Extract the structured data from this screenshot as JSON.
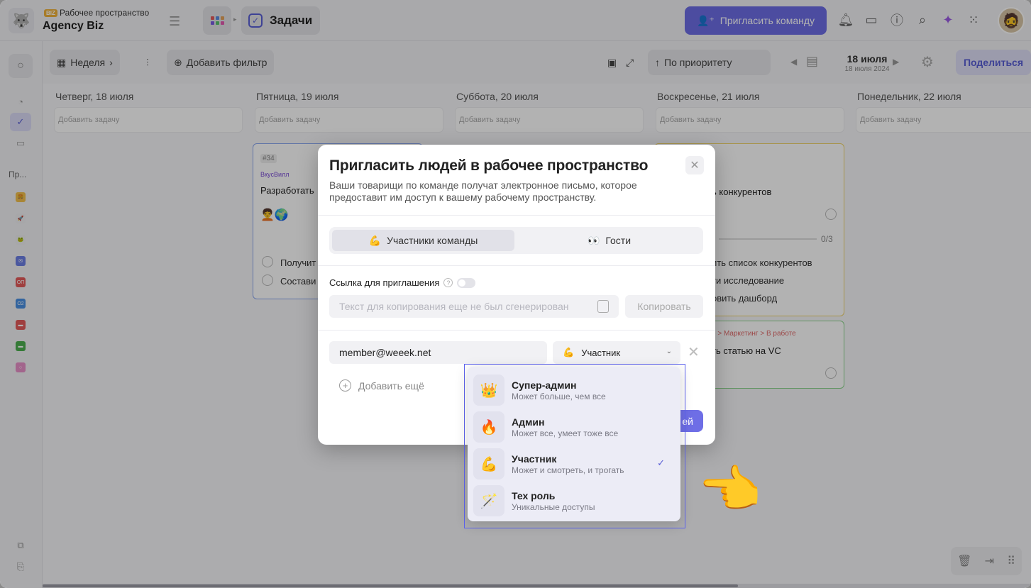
{
  "topbar": {
    "workspace_badge": "BIZ",
    "workspace_label": "Рабочее пространство",
    "workspace_name": "Agency Biz",
    "section_title": "Задачи",
    "invite_team_label": "Пригласить команду"
  },
  "rail": {
    "projects_label": "Пр..."
  },
  "toolbar": {
    "view_label": "Неделя",
    "add_filter_label": "Добавить фильтр",
    "sort_label": "По приоритету",
    "date_main": "18 июля",
    "date_sub": "18 июля 2024",
    "share_label": "Поделиться"
  },
  "board": {
    "columns": [
      {
        "title": "Четверг, 18 июля",
        "add_task": "Добавить задачу"
      },
      {
        "title": "Пятница, 19 июля",
        "add_task": "Добавить задачу"
      },
      {
        "title": "Суббота, 20 июля",
        "add_task": "Добавить задачу"
      },
      {
        "title": "Воскресенье, 21 июля",
        "add_task": "Добавить задачу"
      },
      {
        "title": "Понедельник, 22 июля",
        "add_task": "Добавить задачу"
      }
    ],
    "card1": {
      "tag": "#34",
      "project": "ВкусВилл",
      "title": "Разработать",
      "sub1": "Получит",
      "sub2": "Состави"
    },
    "card2": {
      "title": "ь конкурентов",
      "progress": "0/3",
      "sub1": "ить список конкурентов",
      "sub2": "ти исследование",
      "sub3": "овить дашборд"
    },
    "card3": {
      "crumb": "е > Маркетинг > В работе",
      "title": "ть статью на VC"
    }
  },
  "modal": {
    "title": "Пригласить людей в рабочее пространство",
    "description": "Ваши товарищи по команде получат электронное письмо, которое предоставит им доступ к вашему рабочему пространству.",
    "tabs": [
      {
        "emoji": "💪",
        "label": "Участники команды"
      },
      {
        "emoji": "👀",
        "label": "Гости"
      }
    ],
    "link_label": "Ссылка для приглашения",
    "link_placeholder": "Текст для копирования еще не был сгенерирован",
    "copy_label": "Копировать",
    "email_value": "member@weeek.net",
    "role_emoji": "💪",
    "role_value": "Участник",
    "add_more_label": "Добавить ещё",
    "invite_button_label": "ей"
  },
  "dropdown": {
    "options": [
      {
        "emoji": "👑",
        "name": "Супер-админ",
        "desc": "Может больше, чем все"
      },
      {
        "emoji": "🔥",
        "name": "Админ",
        "desc": "Может все, умеет тоже все"
      },
      {
        "emoji": "💪",
        "name": "Участник",
        "desc": "Может и смотреть, и трогать"
      },
      {
        "emoji": "🪄",
        "name": "Тех роль",
        "desc": "Уникальные доступы"
      }
    ],
    "selected_index": 2
  },
  "colors": {
    "accent": "#6e6ee6",
    "dropdown_outline": "#5d63f0"
  }
}
